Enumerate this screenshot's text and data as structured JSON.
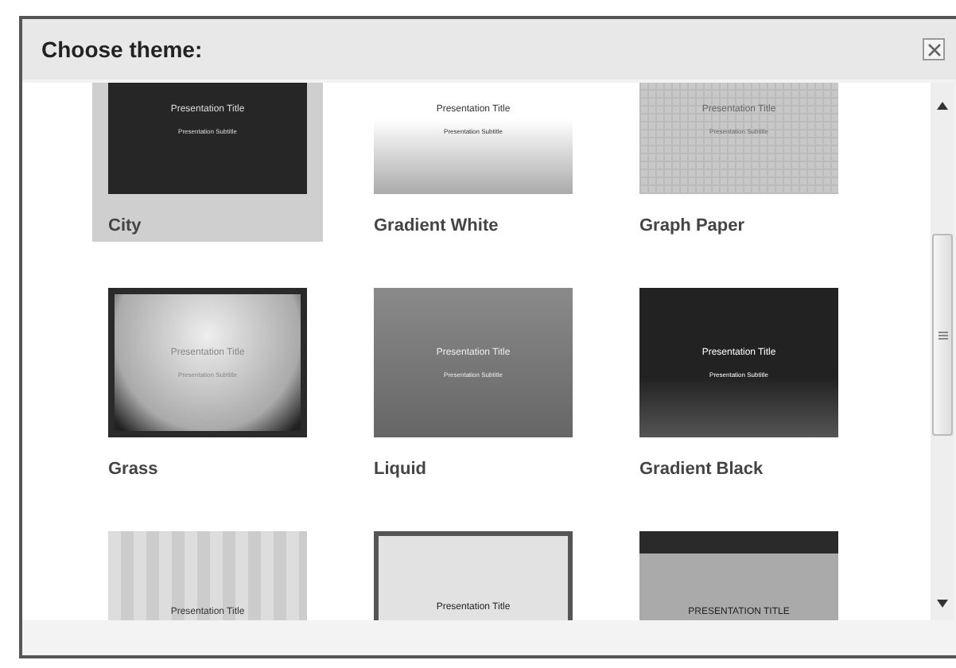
{
  "dialog": {
    "title": "Choose theme:"
  },
  "themes": [
    {
      "name": "City",
      "kind": "city",
      "selected": true,
      "preview_title": "Presentation Title",
      "preview_subtitle": "Presentation Subtitle"
    },
    {
      "name": "Gradient White",
      "kind": "gradient-white",
      "selected": false,
      "preview_title": "Presentation Title",
      "preview_subtitle": "Presentation Subtitle"
    },
    {
      "name": "Graph Paper",
      "kind": "graph-paper",
      "selected": false,
      "preview_title": "Presentation Title",
      "preview_subtitle": "Presentation Subtitle"
    },
    {
      "name": "Grass",
      "kind": "grass",
      "selected": false,
      "preview_title": "Presentation Title",
      "preview_subtitle": "Presentation Subtitle"
    },
    {
      "name": "Liquid",
      "kind": "liquid",
      "selected": false,
      "preview_title": "Presentation Title",
      "preview_subtitle": "Presentation Subtitle"
    },
    {
      "name": "Gradient Black",
      "kind": "gradient-black",
      "selected": false,
      "preview_title": "Presentation Title",
      "preview_subtitle": "Presentation Subtitle"
    },
    {
      "kind": "stripes",
      "selected": false,
      "preview_title": "Presentation Title"
    },
    {
      "kind": "frame",
      "selected": false,
      "preview_title": "Presentation Title"
    },
    {
      "kind": "banner",
      "selected": false,
      "preview_title": "PRESENTATION TITLE"
    }
  ]
}
